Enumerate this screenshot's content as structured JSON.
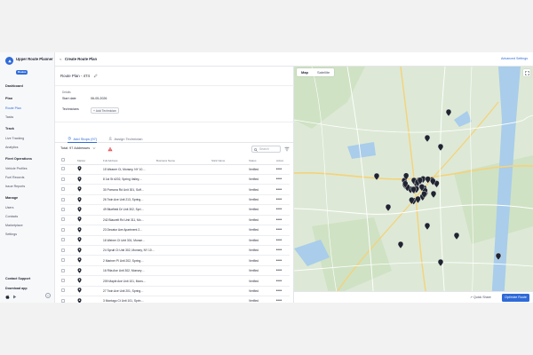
{
  "brand": {
    "name": "Upper Route Planner",
    "badge": "Routes"
  },
  "nav": {
    "dashboard": "Dashboard",
    "plan": {
      "heading": "Plan",
      "items": [
        "Route Plan",
        "Tasks"
      ]
    },
    "track": {
      "heading": "Track",
      "items": [
        "Live Tracking",
        "Analytics"
      ]
    },
    "fleet": {
      "heading": "Fleet Operations",
      "items": [
        "Vehicle Profiles",
        "Fuel Records",
        "Issue Reports"
      ]
    },
    "manage": {
      "heading": "Manage",
      "items": [
        "Users",
        "Contacts",
        "Marketplace",
        "Settings"
      ]
    },
    "contact_support": "Contact Support",
    "download_app": "Download app"
  },
  "topbar": {
    "back": "<",
    "title": "Create Route Plan",
    "advanced": "Advanced Settings"
  },
  "plan": {
    "name": "Route Plan - 474"
  },
  "details": {
    "label": "Details",
    "start_date_label": "Start date",
    "start_date": "06-05-2026",
    "technicians_label": "Technicians",
    "add_technician": "+ Add Technician"
  },
  "tabs": {
    "add_stops": "Add Stops (97)",
    "assign_technician": "Assign Technician"
  },
  "toolbar": {
    "total": "Total: 97 Addresses",
    "search_placeholder": "Search"
  },
  "table": {
    "headers": [
      "",
      "Marker",
      "Full Address",
      "Business Name",
      "Stick Name",
      "Status",
      "Action"
    ],
    "rows": [
      {
        "address": "15 Weaner Ct, Monsey, NY 10…",
        "status": "Verified"
      },
      {
        "address": "8 1st St #202, Spring Valley,…",
        "status": "Verified"
      },
      {
        "address": "30 Pomona Rd Unit 301, Suff…",
        "status": "Verified"
      },
      {
        "address": "26 Twin Ave Unit 213, Spring…",
        "status": "Verified"
      },
      {
        "address": "49 Bluefield Dr Unit 302, Spri…",
        "status": "Verified"
      },
      {
        "address": "242 Blauvelt Rd Unit 311, Mo…",
        "status": "Verified"
      },
      {
        "address": "23 Decatur Ave Apartment 2…",
        "status": "Verified"
      },
      {
        "address": "16 Weiner Ct Unit 301, Monse…",
        "status": "Verified"
      },
      {
        "address": "24 Sprult Ct Unit 302, Monsey, NY 10…",
        "status": "Verified"
      },
      {
        "address": "2 Mariner Pl Unit 202, Spring…",
        "status": "Verified"
      },
      {
        "address": "16 Rita Ave Unit 302, Monsey…",
        "status": "Verified"
      },
      {
        "address": "209 Maple Ave Unit 101, Mons…",
        "status": "Verified"
      },
      {
        "address": "27 Twin Ave Unit 201, Spring…",
        "status": "Verified"
      },
      {
        "address": "3 Montago Ct Unit 101, Sprin…",
        "status": "Verified"
      }
    ]
  },
  "map": {
    "tabs": [
      "Map",
      "Satellite"
    ]
  },
  "bottom": {
    "quick_share": "Quick Share",
    "optimize": "Optimize Route"
  },
  "colors": {
    "accent": "#2f6bd8",
    "map_land": "#d9e8d3",
    "road": "#ffffff",
    "highway": "#f5d27a"
  }
}
